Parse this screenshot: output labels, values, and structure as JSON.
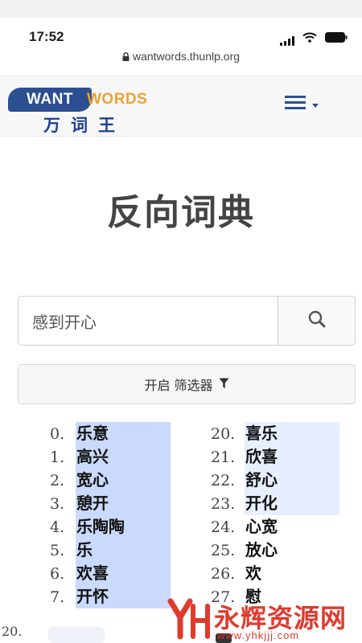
{
  "status_bar": {
    "time": "17:52"
  },
  "browser": {
    "url": "wantwords.thunlp.org"
  },
  "header": {
    "logo_want": "WANT",
    "logo_words": "WORDS",
    "logo_cn": "万词王"
  },
  "page": {
    "title": "反向词典"
  },
  "search": {
    "value": "感到开心"
  },
  "filter": {
    "label": "开启 筛选器"
  },
  "results": {
    "left": [
      {
        "num": "0.",
        "word": "乐意"
      },
      {
        "num": "1.",
        "word": "高兴"
      },
      {
        "num": "2.",
        "word": "宽心"
      },
      {
        "num": "3.",
        "word": "憩开"
      },
      {
        "num": "4.",
        "word": "乐陶陶"
      },
      {
        "num": "5.",
        "word": "乐"
      },
      {
        "num": "6.",
        "word": "欢喜"
      },
      {
        "num": "7.",
        "word": "开怀"
      }
    ],
    "right": [
      {
        "num": "20.",
        "word": "喜乐"
      },
      {
        "num": "21.",
        "word": "欣喜"
      },
      {
        "num": "22.",
        "word": "舒心"
      },
      {
        "num": "23.",
        "word": "开化"
      },
      {
        "num": "24.",
        "word": "心宽"
      },
      {
        "num": "25.",
        "word": "放心"
      },
      {
        "num": "26.",
        "word": "欢"
      },
      {
        "num": "27.",
        "word": "慰"
      }
    ]
  },
  "overlay": {
    "partial_label": "20.",
    "watermark_name": "永辉资源网",
    "watermark_url": "www.yhkjjj.com"
  },
  "colors": {
    "brand_blue": "#2b4f91",
    "brand_orange": "#f0a12d",
    "highlight_strong": "#c9dafc",
    "highlight_light": "#e7effe",
    "watermark_red": "#e03a2d"
  },
  "icons": {
    "search": "magnifier-icon",
    "filter": "funnel-icon",
    "menu": "hamburger-icon",
    "lock": "lock-icon"
  }
}
